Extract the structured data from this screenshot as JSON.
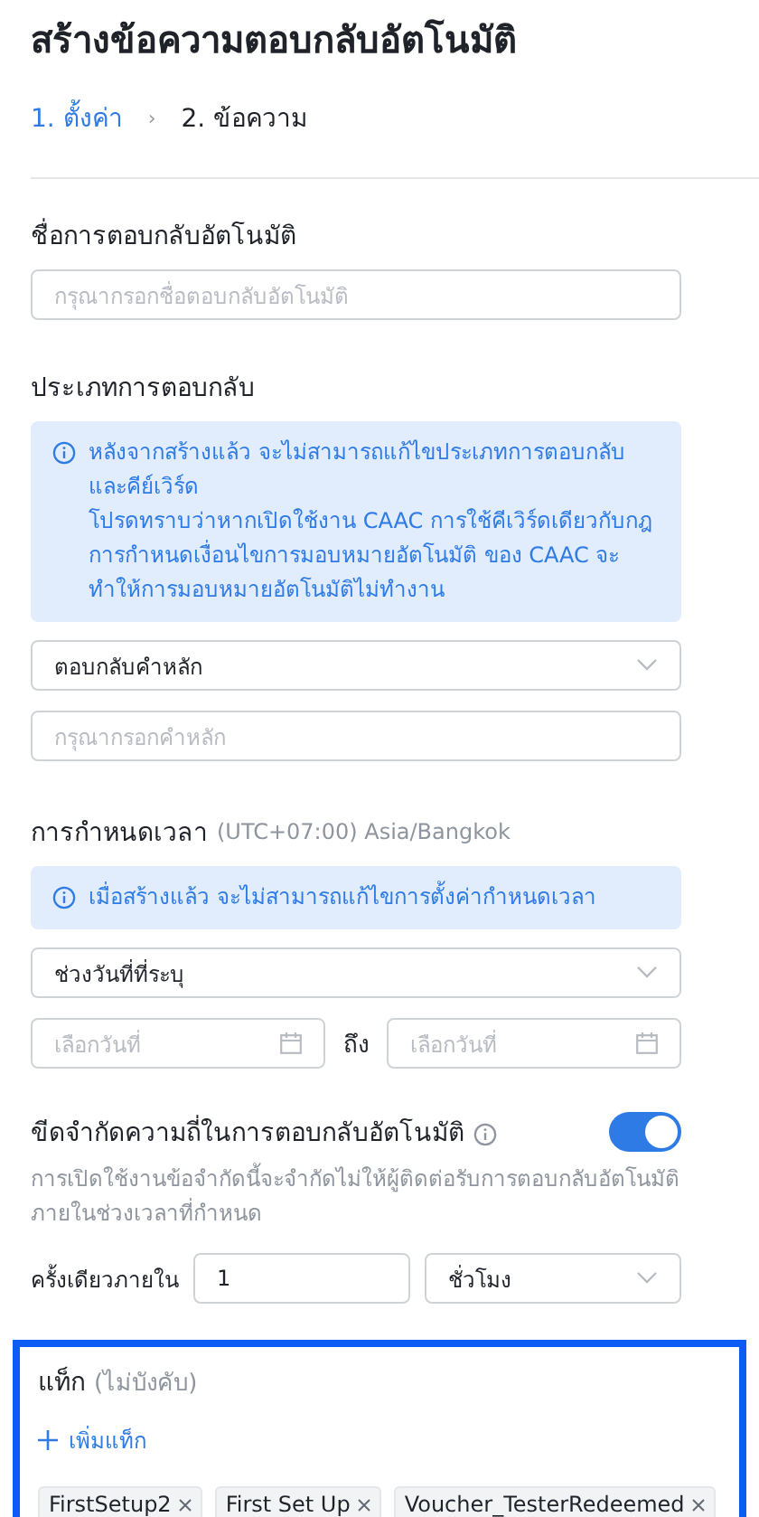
{
  "title": "สร้างข้อความตอบกลับอัตโนมัติ",
  "steps": [
    {
      "label": "1. ตั้งค่า",
      "selected": true
    },
    {
      "label": "2. ข้อความ",
      "selected": false
    }
  ],
  "step_separator": "›",
  "name_section": {
    "label": "ชื่อการตอบกลับอัตโนมัติ",
    "placeholder": "กรุณากรอกชื่อตอบกลับอัตโนมัติ"
  },
  "type_section": {
    "label": "ประเภทการตอบกลับ",
    "notice": [
      "หลังจากสร้างแล้ว จะไม่สามารถแก้ไขประเภทการตอบกลับและคีย์เวิร์ด",
      "โปรดทราบว่าหากเปิดใช้งาน CAAC การใช้คีเวิร์ดเดียวกับกฎการกำหนดเงื่อนไขการมอบหมายอัตโนมัติ ของ CAAC จะทำให้การมอบหมายอัตโนมัติไม่ทำงาน"
    ],
    "select_value": "ตอบกลับคำหลัก",
    "keyword_placeholder": "กรุณากรอกคำหลัก"
  },
  "schedule_section": {
    "label": "การกำหนดเวลา",
    "timezone": "(UTC+07:00) Asia/Bangkok",
    "notice": [
      "เมื่อสร้างแล้ว จะไม่สามารถแก้ไขการตั้งค่ากำหนดเวลา"
    ],
    "select_value": "ช่วงวันที่ที่ระบุ",
    "start_placeholder": "เลือกวันที่",
    "to_label": "ถึง",
    "end_placeholder": "เลือกวันที่"
  },
  "frequency_section": {
    "label": "ขีดจำกัดความถี่ในการตอบกลับอัตโนมัติ",
    "on": true,
    "description": "การเปิดใช้งานข้อจำกัดนี้จะจำกัดไม่ให้ผู้ติดต่อรับการตอบกลับอัตโนมัติภายในช่วงเวลาที่กำหนด",
    "once_within_label": "ครั้งเดียวภายใน",
    "amount": "1",
    "unit": "ชั่วโมง"
  },
  "tags_section": {
    "label": "แท็ก",
    "optional": "(ไม่บังคับ)",
    "add_label": "เพิ่มแท็ก",
    "tags": [
      "FirstSetup2",
      "First Set Up",
      "Voucher_TesterRedeemed"
    ]
  }
}
